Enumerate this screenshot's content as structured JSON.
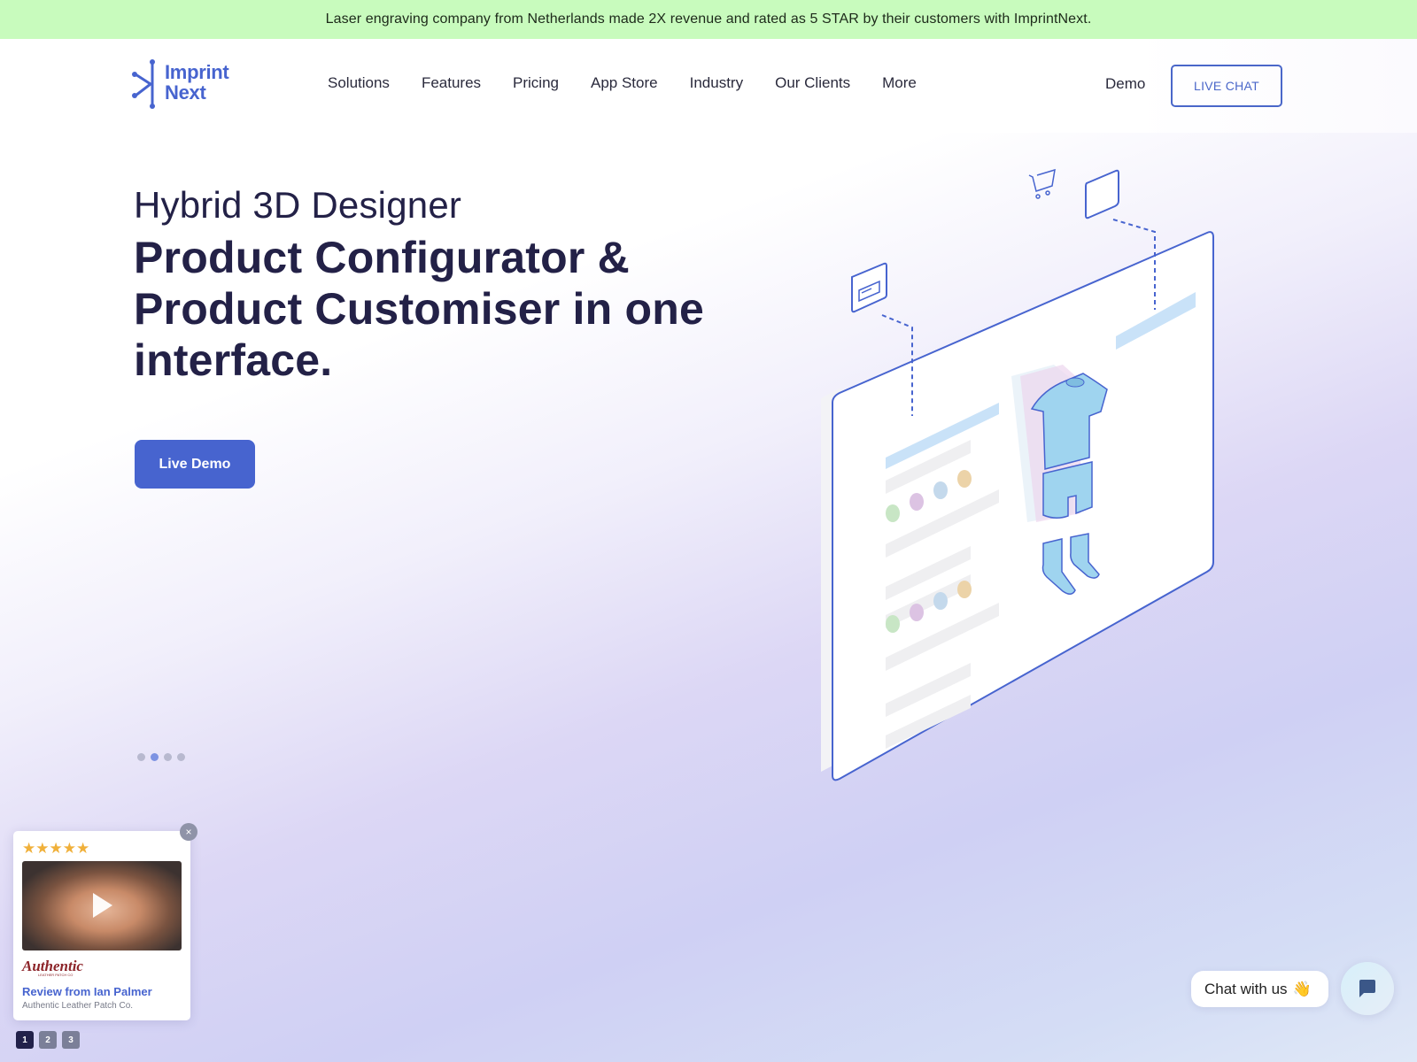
{
  "announcement": "Laser engraving company from Netherlands made 2X revenue and rated as 5 STAR by their customers with ImprintNext.",
  "header": {
    "logo": {
      "line1": "Imprint",
      "line2": "Next"
    },
    "nav": [
      "Solutions",
      "Features",
      "Pricing",
      "App Store",
      "Industry",
      "Our Clients",
      "More"
    ],
    "demo_label": "Demo",
    "live_chat_label": "LIVE CHAT"
  },
  "hero": {
    "subtitle": "Hybrid 3D Designer",
    "title": "Product Configurator & Product Customiser in one interface.",
    "cta_label": "Live Demo",
    "slides": {
      "count": 4,
      "active_index": 1
    }
  },
  "illustration": {
    "swatch_colors": [
      "#c8e6c5",
      "#dcc3e3",
      "#c4d9ec",
      "#ecd3a8"
    ],
    "accent_color": "#4764cf",
    "garment_color": "#9fd4ef"
  },
  "review_widget": {
    "rating_stars": 5,
    "stars_text": "★★★★★",
    "close_icon": "×",
    "brand_name": "Authentic",
    "brand_sub": "LEATHER PATCH CO",
    "reviewer_title": "Review from Ian Palmer",
    "company": "Authentic Leather Patch Co.",
    "pages": [
      "1",
      "2",
      "3"
    ],
    "active_page": 0
  },
  "chat": {
    "label": "Chat with us",
    "emoji": "👋"
  },
  "colors": {
    "brand": "#4764cf",
    "heading": "#232147",
    "announcement_bg": "#c8fbbd"
  }
}
